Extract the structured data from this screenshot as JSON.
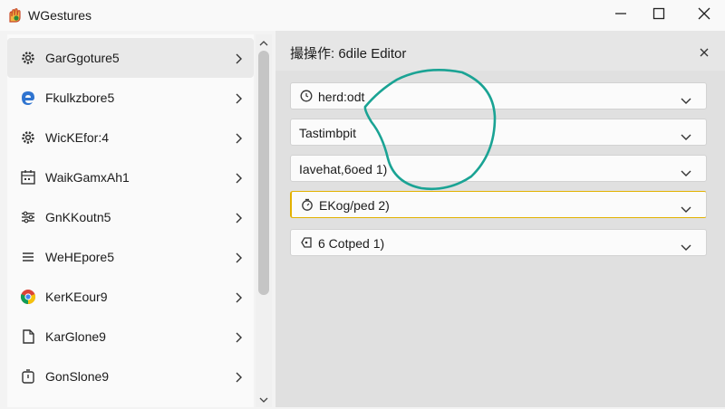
{
  "window": {
    "title": "WGestures",
    "icon": "gesture-app-icon",
    "controls": [
      "minimize-icon",
      "maximize-icon",
      "close-icon"
    ]
  },
  "sidebar": {
    "items": [
      {
        "label": "GarGgoture5",
        "icon": "gear-icon",
        "selected": true
      },
      {
        "label": "Fkulkzbore5",
        "icon": "edge-browser-icon",
        "selected": false
      },
      {
        "label": "WicKEfor:4",
        "icon": "gear-icon",
        "selected": false
      },
      {
        "label": "WaikGamxAh1",
        "icon": "calendar-icon",
        "selected": false
      },
      {
        "label": "GnKKoutn5",
        "icon": "settings-list-icon",
        "selected": false
      },
      {
        "label": "WeHEpore5",
        "icon": "list-icon",
        "selected": false
      },
      {
        "label": "KerKEour9",
        "icon": "chrome-icon",
        "selected": false
      },
      {
        "label": "KarGlone9",
        "icon": "document-icon",
        "selected": false
      },
      {
        "label": "GonSlone9",
        "icon": "timer-icon",
        "selected": false
      }
    ]
  },
  "editor": {
    "title": "撮操作: 6dile Editor",
    "fields": [
      {
        "label": "herd:odt",
        "icon": "clock-icon",
        "highlight": false
      },
      {
        "label": "Tastimbpit",
        "icon": null,
        "highlight": false
      },
      {
        "label": "Iavehat,6oed 1)",
        "icon": null,
        "highlight": false
      },
      {
        "label": "EKog/ped 2)",
        "icon": "timer-icon",
        "highlight": true
      },
      {
        "label": "6 Cotped 1)",
        "icon": "tag-icon",
        "highlight": false
      }
    ]
  },
  "colors": {
    "gesture_trail": "#1aa394",
    "highlight": "#e3b100",
    "selected_bg": "#e9e9e9"
  }
}
